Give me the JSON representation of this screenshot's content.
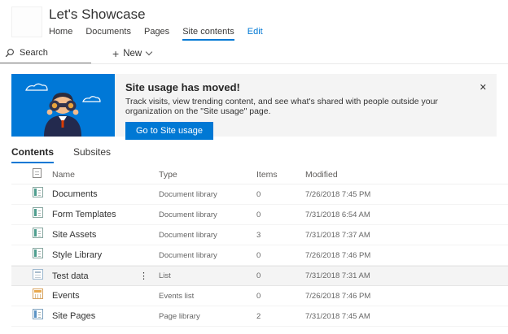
{
  "header": {
    "site_title": "Let's Showcase",
    "nav": [
      {
        "label": "Home"
      },
      {
        "label": "Documents"
      },
      {
        "label": "Pages"
      },
      {
        "label": "Site contents"
      },
      {
        "label": "Edit"
      }
    ]
  },
  "command_bar": {
    "search_placeholder": "Search",
    "new_label": "New"
  },
  "banner": {
    "title": "Site usage has moved!",
    "message": "Track visits, view trending content, and see what's shared with people outside your organization on the \"Site usage\" page.",
    "button_label": "Go to Site usage",
    "close_glyph": "✕"
  },
  "tabs": [
    {
      "label": "Contents"
    },
    {
      "label": "Subsites"
    }
  ],
  "table": {
    "columns": [
      "Name",
      "Type",
      "Items",
      "Modified"
    ],
    "menu_glyph": "⋮",
    "rows": [
      {
        "name": "Documents",
        "type": "Document library",
        "items": "0",
        "modified": "7/26/2018 7:45 PM",
        "icon": "document-library",
        "selected": false
      },
      {
        "name": "Form Templates",
        "type": "Document library",
        "items": "0",
        "modified": "7/31/2018 6:54 AM",
        "icon": "document-library",
        "selected": false
      },
      {
        "name": "Site Assets",
        "type": "Document library",
        "items": "3",
        "modified": "7/31/2018 7:37 AM",
        "icon": "document-library",
        "selected": false
      },
      {
        "name": "Style Library",
        "type": "Document library",
        "items": "0",
        "modified": "7/26/2018 7:46 PM",
        "icon": "document-library",
        "selected": false
      },
      {
        "name": "Test data",
        "type": "List",
        "items": "0",
        "modified": "7/31/2018 7:31 AM",
        "icon": "list",
        "selected": true
      },
      {
        "name": "Events",
        "type": "Events list",
        "items": "0",
        "modified": "7/26/2018 7:46 PM",
        "icon": "events",
        "selected": false
      },
      {
        "name": "Site Pages",
        "type": "Page library",
        "items": "2",
        "modified": "7/31/2018 7:45 AM",
        "icon": "page-library",
        "selected": false
      }
    ]
  },
  "colors": {
    "accent": "#0078d4",
    "banner_bg": "#f4f4f4",
    "banner_image_bg": "#0078d7",
    "selected_row_bg": "#f4f4f4"
  }
}
